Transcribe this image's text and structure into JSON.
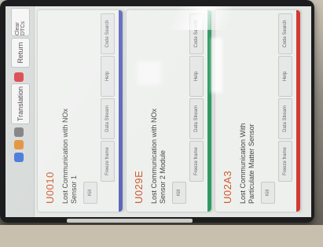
{
  "toolbar": {
    "clear_label": "Clear DTCs",
    "return_label": "Return",
    "translation_label": "Translation"
  },
  "cards": [
    {
      "code": "U0010",
      "description": "Lost Communication with NOx Sensor 1",
      "freeze_frame_label": "Freeze frame",
      "data_stream_label": "Data Stream",
      "code_search_label": "Code Search",
      "help_label": "Help",
      "kill_label": "Kill",
      "bar_color": "#5a64b8"
    },
    {
      "code": "U029E",
      "description": "Lost Communication with NOx Sensor 2 Module",
      "freeze_frame_label": "Freeze frame",
      "data_stream_label": "Data Stream",
      "code_search_label": "Code Search",
      "help_label": "Help",
      "kill_label": "Kill",
      "bar_color": "#2f9a63"
    },
    {
      "code": "U02A3",
      "description": "Lost Communication With Particulate Matter Sensor",
      "freeze_frame_label": "Freeze frame",
      "data_stream_label": "Data Stream",
      "code_search_label": "Code Search",
      "help_label": "Help",
      "kill_label": "Kill",
      "bar_color": "#d23a33"
    }
  ],
  "colors": {
    "code_text": "#d0582c",
    "accent_blue": "#3b6fd8",
    "accent_red": "#d9363c"
  }
}
